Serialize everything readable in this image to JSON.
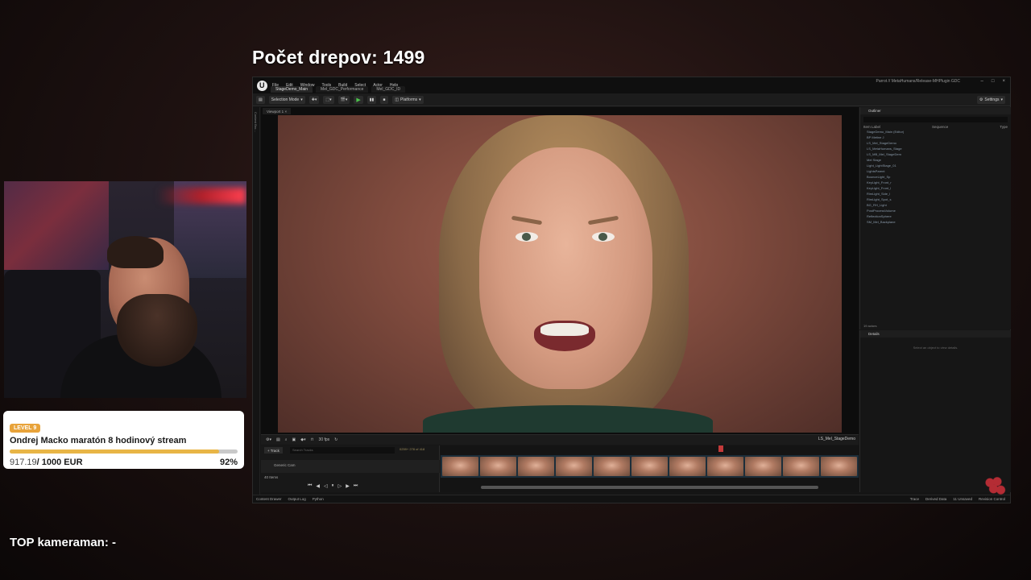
{
  "overlay": {
    "drep_label": "Počet drepov: 1499",
    "top_cam_label": "TOP kameraman: -"
  },
  "goal": {
    "level": "LEVEL 9",
    "title": "Ondrej Macko maratón 8 hodinový stream",
    "current": "917.19",
    "total": "/ 1000 EUR",
    "percent_label": "92%",
    "progress": 0.92,
    "colors": {
      "accent": "#e8b546",
      "badge": "#e8a33a"
    }
  },
  "editor": {
    "menu": [
      "File",
      "Edit",
      "Window",
      "Tools",
      "Build",
      "Select",
      "Actor",
      "Help"
    ],
    "tabs": [
      "StageDemo_Main",
      "Mel_GDC_Performance",
      "Mel_GDC_ID"
    ],
    "project": "Parrot // MetaHumans/Release-MHPlugin GDC",
    "toolbar": {
      "mode": "Selection Mode",
      "platforms": "Platforms",
      "settings": "Settings"
    },
    "viewport_tab": "Viewport 1",
    "side_strip": "Content Bro...",
    "sequencer": {
      "add_track": "+ Track",
      "search_placeholder": "Search Tracks",
      "counter": "0259+  278 of 418",
      "fps": "30 fps",
      "sequence_name": "LS_Mel_StageDemo",
      "track_name": "Generic Cam",
      "items": "40 Items",
      "playhead_frame": "0259+"
    },
    "outliner": {
      "tab": "Outliner",
      "col_label": "Item Label",
      "col_sequence": "Sequence",
      "col_type": "Type",
      "rows": [
        "StageDemo_Main (Editor)",
        "BP Metine J",
        "LS_Mel_StageDemo",
        "LS_MetaHumans_Stage",
        "LS_MB_Mel_StageDem",
        "Mel Stage",
        "Light_LightStage_01",
        "LightsParent",
        "BounceLight_Sp",
        "KeyLight_Front_r",
        "KeyLight_Front_l",
        "RimLight_Side_l",
        "RimLight_Spot_s",
        "BG_RH_Light",
        "PostProcessVolume",
        "ReflectionSphere",
        "SM_Mel_Backplane"
      ],
      "count": "19 actors"
    },
    "details": {
      "tab": "Details",
      "message": "Select an object to view details."
    },
    "status": {
      "content_drawer": "Content Drawer",
      "output_log": "Output Log",
      "cmd": "Python",
      "trace": "Trace",
      "derived_data": "Derived Data",
      "unsaved": "11 Unsaved",
      "revision": "Revision Control"
    }
  }
}
